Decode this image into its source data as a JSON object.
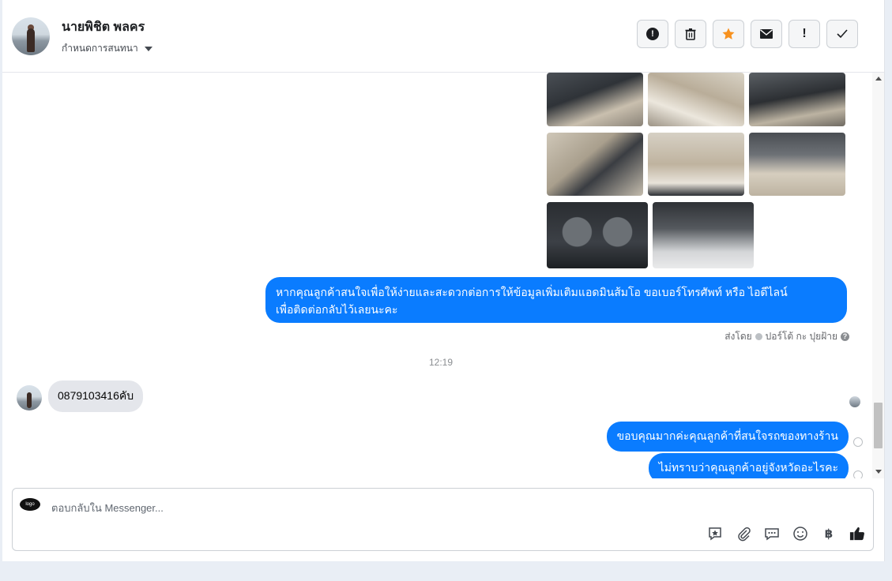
{
  "header": {
    "contact_name": "นายพิชิต พลคร",
    "assign_label": "กำหนดการสนทนา",
    "actions": {
      "spam_icon": "!",
      "delete_icon": "🗑",
      "star_icon": "★",
      "mail_icon": "✉",
      "important_icon": "!",
      "done_icon": "✓"
    }
  },
  "thread": {
    "message_info": "หากคุณลูกค้าสนใจเพื่อให้ง่ายและสะดวกต่อการให้ข้อมูลเพิ่มเติมแอดมินส้มโอ ขอเบอร์โทรศัพท์ หรือ ไอดีไลน์",
    "message_info_line2": "เพื่อติดต่อกลับไว้เลยนะคะ",
    "sent_by_label": "ส่งโดย",
    "sent_by_name": "ปอร์โต้ กะ ปุยฝ้าย",
    "timestamp": "12:19",
    "incoming_message": "0879103416คับ",
    "reply_1": "ขอบคุณมากค่ะคุณลูกค้าที่สนใจรถของทางร้าน",
    "reply_2": "ไม่ทราบว่าคุณลูกค้าอยู่จังหวัดอะไรคะ"
  },
  "composer": {
    "placeholder": "ตอบกลับใน Messenger...",
    "brand_logo_text": "logo",
    "tools": {
      "saved_reply_icon": "☆",
      "attach_icon": "📎",
      "chat_icon": "…",
      "emoji_icon": "☺",
      "payment_icon": "฿",
      "like_icon": "👍"
    }
  },
  "colors": {
    "accent": "#0a7cff",
    "star": "#f7911e",
    "incoming_bg": "#e4e6eb"
  }
}
